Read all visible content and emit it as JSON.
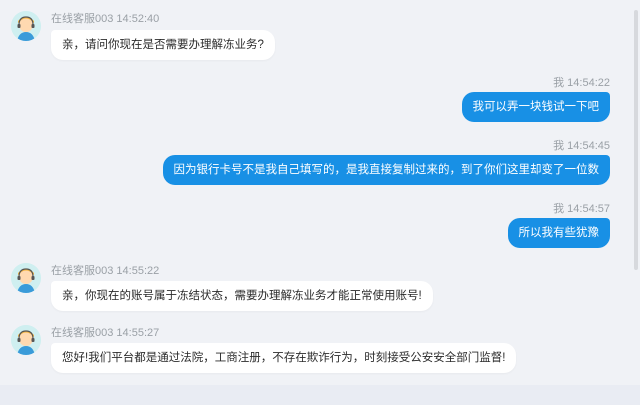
{
  "messages": [
    {
      "sender": "在线客服003",
      "time": "14:52:40",
      "side": "in",
      "text": "亲，请问你现在是否需要办理解冻业务?"
    },
    {
      "sender": "我",
      "time": "14:54:22",
      "side": "out",
      "text": "我可以弄一块钱试一下吧"
    },
    {
      "sender": "我",
      "time": "14:54:45",
      "side": "out",
      "text": "因为银行卡号不是我自己填写的，是我直接复制过来的，到了你们这里却变了一位数"
    },
    {
      "sender": "我",
      "time": "14:54:57",
      "side": "out",
      "text": "所以我有些犹豫"
    },
    {
      "sender": "在线客服003",
      "time": "14:55:22",
      "side": "in",
      "text": "亲，你现在的账号属于冻结状态，需要办理解冻业务才能正常使用账号!"
    },
    {
      "sender": "在线客服003",
      "time": "14:55:27",
      "side": "in",
      "text": "您好!我们平台都是通过法院，工商注册，不存在欺诈行为，时刻接受公安安全部门监督!"
    }
  ],
  "colors": {
    "background": "#f0f2f6",
    "outgoing_bubble": "#1890e5",
    "incoming_bubble": "#ffffff",
    "meta_text": "#9aa0a6"
  },
  "icons": {
    "agent_avatar": "customer-service-agent-avatar-icon"
  }
}
